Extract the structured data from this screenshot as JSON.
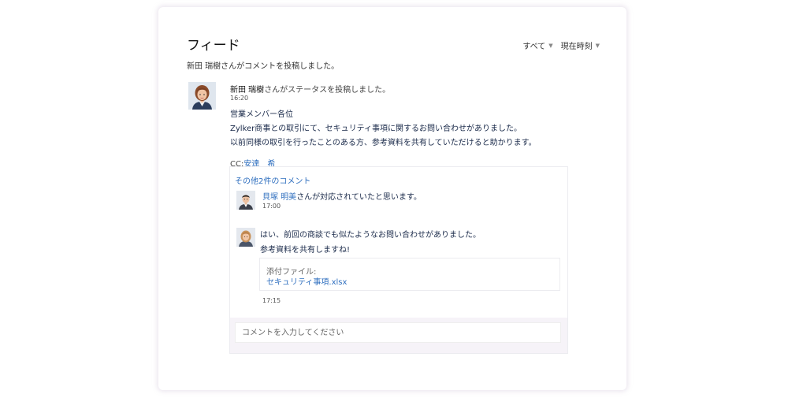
{
  "feed": {
    "title": "フィード",
    "filters": {
      "all": "すべて",
      "time": "現在時刻"
    },
    "summary": "新田 瑞樹さんがコメントを投稿しました。"
  },
  "post": {
    "author": "新田 瑞樹",
    "action": "さんがステータスを投稿しました。",
    "time": "16:20",
    "body": [
      "営業メンバー各位",
      "Zylker商事との取引にて、セキュリティ事項に関するお問い合わせがありました。",
      "以前同様の取引を行ったことのある方、参考資料を共有していただけると助かります。"
    ],
    "cc_label": "CC:",
    "cc_name": "安達　希"
  },
  "comments": {
    "more_link": "その他2件のコメント",
    "items": [
      {
        "mention": "貝塚 明美",
        "text": "さんが対応されていたと思います。",
        "time": "17:00"
      },
      {
        "lines": [
          "はい、前回の商談でも似たようなお問い合わせがありました。",
          "参考資料を共有しますね!"
        ],
        "attachment_label": "添付ファイル:",
        "attachment_file": "セキュリティ事項.xlsx",
        "time": "17:15"
      }
    ],
    "input_placeholder": "コメントを入力してください"
  },
  "colors": {
    "link": "#2f6fbf",
    "body_text": "#1a2a4a",
    "card_shadow": "#c8b9d2"
  }
}
